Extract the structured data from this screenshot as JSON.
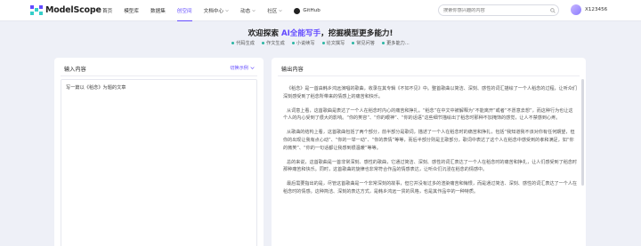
{
  "nav": {
    "logo_text": "ModelScope",
    "items": [
      {
        "label": "首页"
      },
      {
        "label": "模型库"
      },
      {
        "label": "数据集"
      },
      {
        "label": "创空间"
      },
      {
        "label": "文档中心"
      },
      {
        "label": "动态"
      },
      {
        "label": "社区"
      },
      {
        "label": "GitHub"
      }
    ],
    "active_index": 3,
    "search_placeholder": "搜索你感兴趣的内容",
    "username": "X123456"
  },
  "hero": {
    "title_prefix": "欢迎探索 ",
    "title_accent": "AI全能写手",
    "title_suffix": "，挖掘模型更多能力!",
    "features": [
      "代码生成",
      "作文生成",
      "小说续写",
      "论文撰写",
      "常见问答",
      "更多能力..."
    ]
  },
  "input_panel": {
    "title": "输入内容",
    "switch_label": "切换示例",
    "value": "写一篇以《稻念》为题的文章"
  },
  "output_panel": {
    "title": "输出内容",
    "paragraphs": [
      "《稻念》是一首由韩乡鸿远演唱的歌曲，收录在其专辑《不如不见》中。整首歌曲以简洁、深刻、感性的词汇描绘了一个人稻念的过程，让听众们深刻感受到了稻念所带来的情感上的痛苦和快乐。",
      "从词意上看，这首歌曲是表达了一个人在稻念时内心的痛苦和挣扎。“稻念”在中文中被解释为“不能离开”或者“不愿意去想”，而这种行为也让这个人的内心受到了很大的影响。“你的笑容”、“你的眼神”、“你的话语”这些细节描绘出了稻念时那种不加掩饰的感觉，让人不禁感到心疼。",
      "从歌曲的结构上看，这首歌曲包括了两个部分，前半部分是歌词，描述了一个人在稻念时的痛苦和挣扎，包括“我知道我不该对你有任何期望，但你的出现让我有点心动”、“你的一举一动”、“你的表情”等等，而后半部分则是主歌部分，歌词中表达了这个人在稻念中感受到的孝和满足，如“你的微笑”、“你的一句话都让我感到很温暖”等等。",
      "总的来说，这首歌曲是一首非常深刻、感性的歌曲，它通过简洁、深刻、感性的词汇表达了一个人在稻念时的痛苦和挣扎，让人们感受到了稻念时那种痛苦和快乐。同时，这首歌曲的旋律也非常符合作品的情感表达，让听众们沉浸在稻念的情感中。",
      "最后需要指出的是，尽管这首歌曲是一个非常深刻的故事，但它并没有过多的渲染痛苦和悔恨，而是通过简洁、深刻、感性的词汇表达了一个人在稻念时的情感。这种简洁、深刻的表达方式，是韩乡鸿远一贯的风格，也是其作品中的一种特质。"
    ]
  },
  "colors": {
    "accent": "#624aff",
    "feature_dot": "#2bb5a3",
    "background": "#eef0f7"
  }
}
